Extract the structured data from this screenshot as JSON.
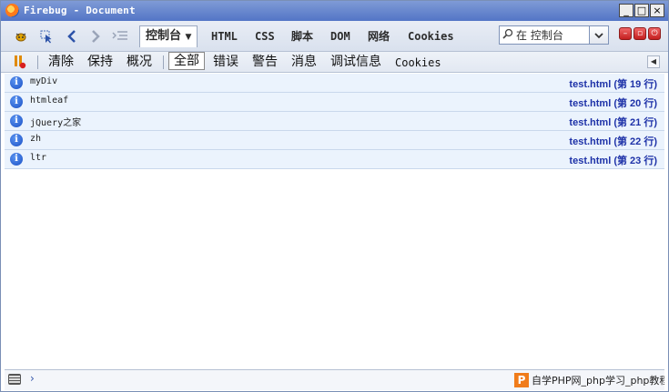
{
  "window": {
    "title": "Firebug - Document",
    "buttons": {
      "minimize": "_",
      "maximize": "□",
      "close": "×"
    }
  },
  "toolbar": {
    "panels": [
      {
        "label": "控制台",
        "selected": true
      },
      {
        "label": "HTML"
      },
      {
        "label": "CSS"
      },
      {
        "label": "脚本"
      },
      {
        "label": "DOM"
      },
      {
        "label": "网络"
      },
      {
        "label": "Cookies"
      }
    ],
    "search_text": "在 控制台",
    "icons": [
      "firebug-icon",
      "inspect-icon",
      "back-icon",
      "forward-icon",
      "command-icon"
    ]
  },
  "console_toolbar": {
    "clear": "清除",
    "persist": "保持",
    "profile": "概况",
    "filters": [
      "全部",
      "错误",
      "警告",
      "消息",
      "调试信息",
      "Cookies"
    ],
    "selected_filter": "全部"
  },
  "log": [
    {
      "message": "myDiv",
      "source": "test.html (第 19 行)"
    },
    {
      "message": "htmleaf",
      "source": "test.html (第 20 行)"
    },
    {
      "message": "jQuery之家",
      "source": "test.html (第 21 行)"
    },
    {
      "message": "zh",
      "source": "test.html (第 22 行)"
    },
    {
      "message": "ltr",
      "source": "test.html (第 23 行)"
    }
  ],
  "command_line": {
    "prompt": "›"
  },
  "watermark": {
    "logo": "P",
    "text": "自学PHP网_php学习_php教程"
  }
}
